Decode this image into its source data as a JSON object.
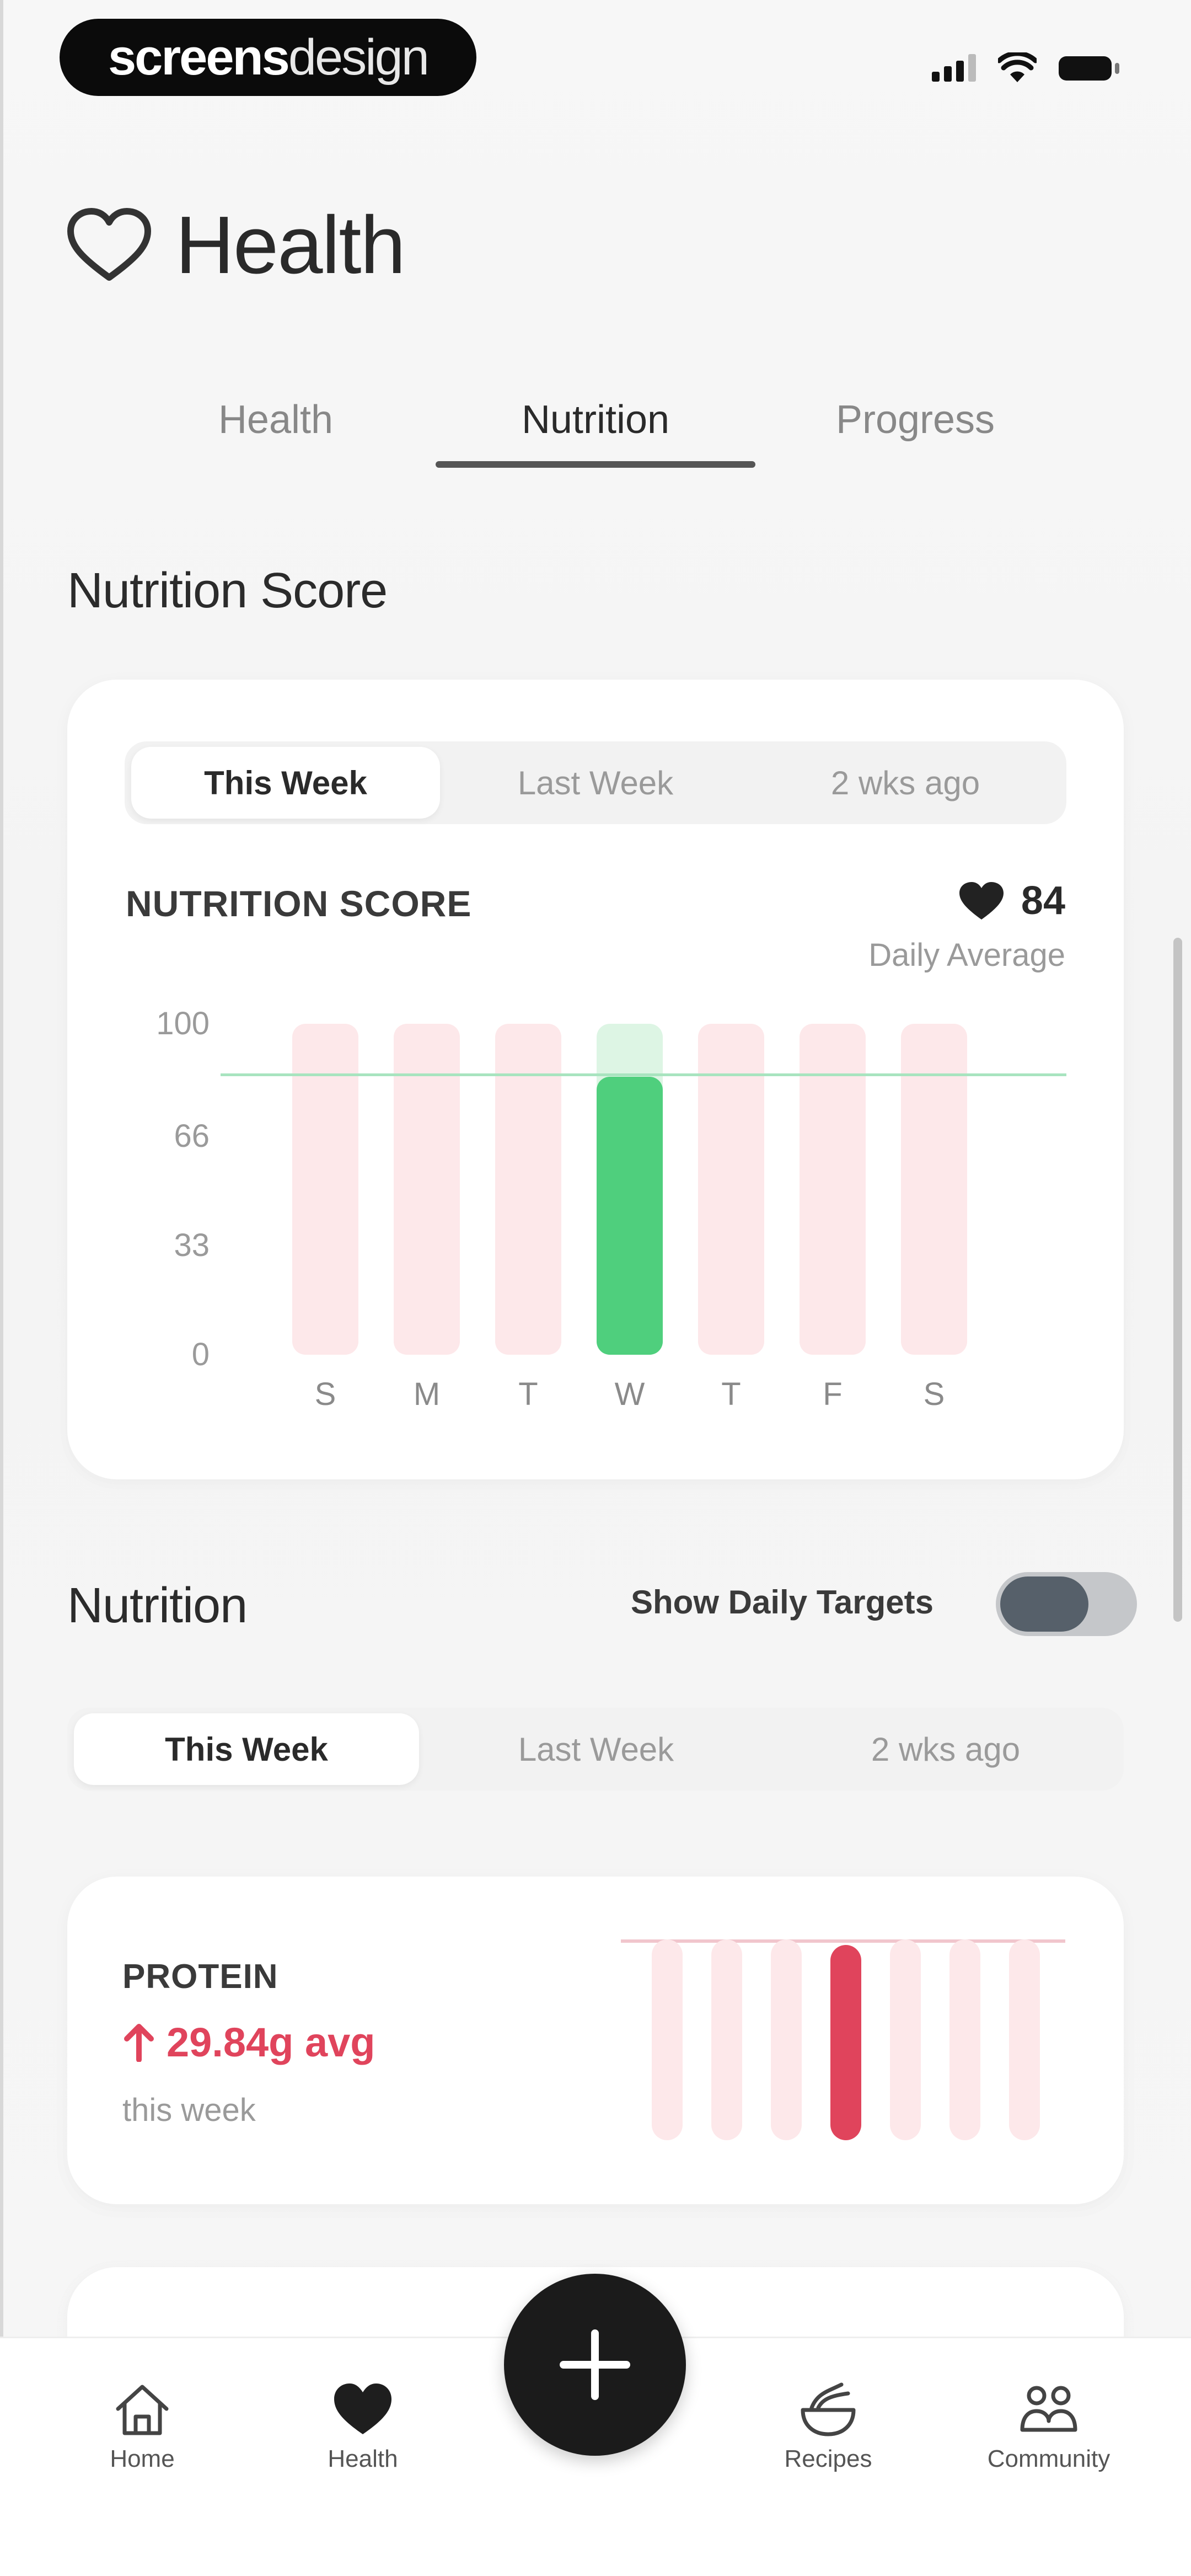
{
  "status_bar": {
    "brand_bold": "screens",
    "brand_thin": "design"
  },
  "header": {
    "title": "Health",
    "icon": "heart-outline-icon"
  },
  "top_tabs": [
    {
      "label": "Health",
      "active": false
    },
    {
      "label": "Nutrition",
      "active": true
    },
    {
      "label": "Progress",
      "active": false
    }
  ],
  "score_section": {
    "title": "Nutrition Score",
    "periods": [
      "This Week",
      "Last Week",
      "2 wks ago"
    ],
    "selected_period": "This Week",
    "chart_label": "NUTRITION SCORE",
    "score": "84",
    "score_caption": "Daily Average"
  },
  "chart_data": {
    "type": "bar",
    "categories": [
      "S",
      "M",
      "T",
      "W",
      "T",
      "F",
      "S"
    ],
    "values": [
      0,
      0,
      0,
      84,
      0,
      0,
      0
    ],
    "target": 85,
    "ylim": [
      0,
      100
    ],
    "yticks": [
      "100",
      "66",
      "33",
      "0"
    ],
    "colors": {
      "filled": "#4fcf7d",
      "empty": "#fde8ea",
      "target": "#a8e4bf"
    }
  },
  "nutrition_section": {
    "title": "Nutrition",
    "toggle_label": "Show Daily Targets",
    "toggle_on": true,
    "periods": [
      "This Week",
      "Last Week",
      "2 wks ago"
    ],
    "selected_period": "This Week"
  },
  "protein": {
    "label": "PROTEIN",
    "avg": "29.84g avg",
    "sub": "this week",
    "mini_values": [
      0,
      0,
      0,
      1,
      0,
      0,
      0
    ],
    "color": "#e0445c"
  },
  "bottom_nav": [
    {
      "label": "Home",
      "icon": "home-icon"
    },
    {
      "label": "Health",
      "icon": "heart-icon"
    },
    {
      "label": "Recipes",
      "icon": "recipes-icon"
    },
    {
      "label": "Community",
      "icon": "community-icon"
    }
  ],
  "fab": {
    "icon": "plus-icon"
  }
}
